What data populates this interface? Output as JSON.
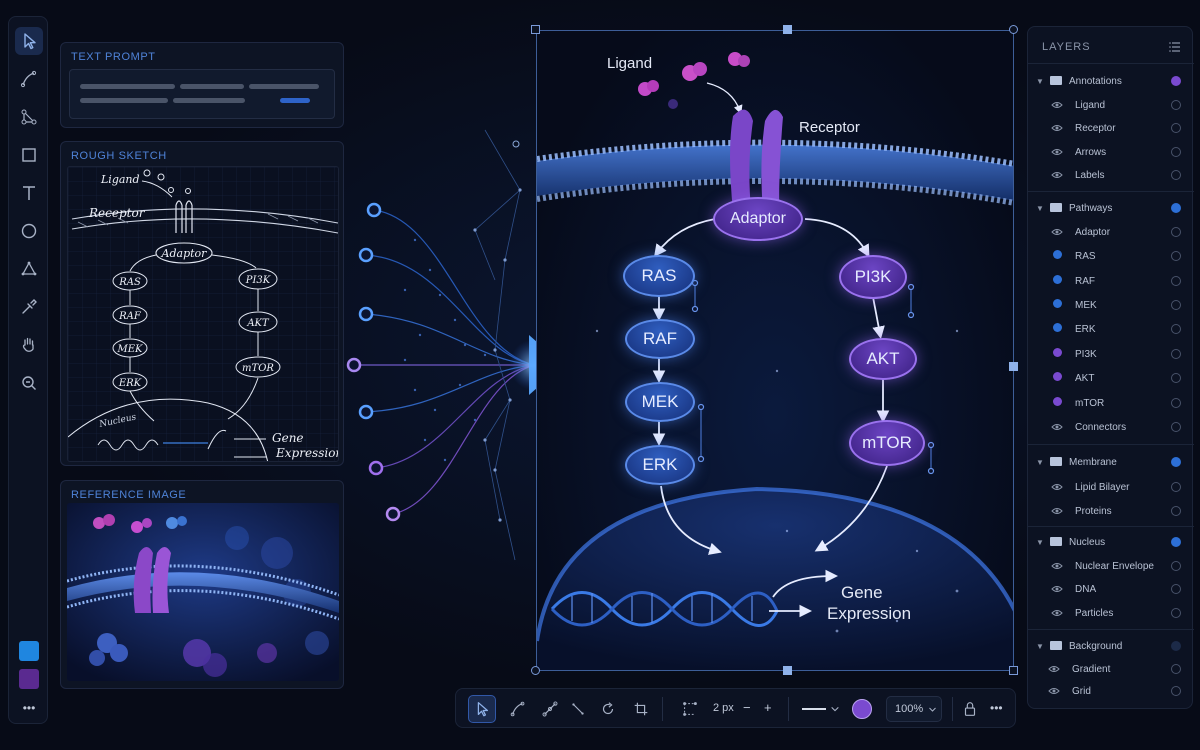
{
  "toolbar_left": {
    "tools": [
      "select-tool",
      "pen-tool",
      "node-tool",
      "rectangle-tool",
      "text-tool",
      "ellipse-tool",
      "triangle-tool",
      "eyedropper-tool",
      "hand-tool",
      "zoom-tool"
    ],
    "swatches": [
      "#1f86e0",
      "#5a2a90"
    ],
    "more_label": "•••"
  },
  "panels": {
    "text_prompt": {
      "title": "TEXT PROMPT"
    },
    "rough_sketch": {
      "title": "ROUGH SKETCH",
      "labels": {
        "ligand": "Ligand",
        "receptor": "Receptor",
        "adaptor": "Adaptor",
        "ras": "RAS",
        "raf": "RAF",
        "mek": "MEK",
        "erk": "ERK",
        "pi3k": "PI3K",
        "akt": "AKT",
        "mtor": "mTOR",
        "nucleus": "Nucleus",
        "gene": "Gene",
        "expression": "Expression"
      }
    },
    "reference_image": {
      "title": "REFERENCE IMAGE"
    }
  },
  "canvas": {
    "ligand": "Ligand",
    "receptor": "Receptor",
    "adaptor": "Adaptor",
    "ras": "RAS",
    "raf": "RAF",
    "mek": "MEK",
    "erk": "ERK",
    "pi3k": "PI3K",
    "akt": "AKT",
    "mtor": "mTOR",
    "gene": "Gene",
    "expression": "Expression"
  },
  "layers": {
    "title": "LAYERS",
    "groups": [
      {
        "name": "Annotations",
        "color": "#7a4ad0",
        "items": [
          "Ligand",
          "Receptor",
          "Arrows",
          "Labels"
        ]
      },
      {
        "name": "Pathways",
        "color": "#2d6fd6",
        "items": [
          "Adaptor",
          "RAS",
          "RAF",
          "MEK",
          "ERK",
          "PI3K",
          "AKT",
          "mTOR",
          "Connectors"
        ]
      },
      {
        "name": "Membrane",
        "color": "#2d6fd6",
        "items": [
          "Lipid Bilayer",
          "Proteins"
        ]
      },
      {
        "name": "Nucleus",
        "color": "#2d6fd6",
        "items": [
          "Nuclear Envelope",
          "DNA",
          "Particles"
        ]
      },
      {
        "name": "Background",
        "color": "#1c2a48",
        "items": [
          "Gradient",
          "Grid"
        ]
      }
    ],
    "item_dots": {
      "RAS": "#2d6fd6",
      "RAF": "#2d6fd6",
      "MEK": "#2d6fd6",
      "ERK": "#2d6fd6",
      "PI3K": "#7a4ad0",
      "AKT": "#7a4ad0",
      "mTOR": "#7a4ad0"
    }
  },
  "bottom_toolbar": {
    "stroke_width": "2 px",
    "minus": "−",
    "plus": "+",
    "zoom": "100%",
    "color": "#7a4ad0",
    "more_label": "•••"
  }
}
